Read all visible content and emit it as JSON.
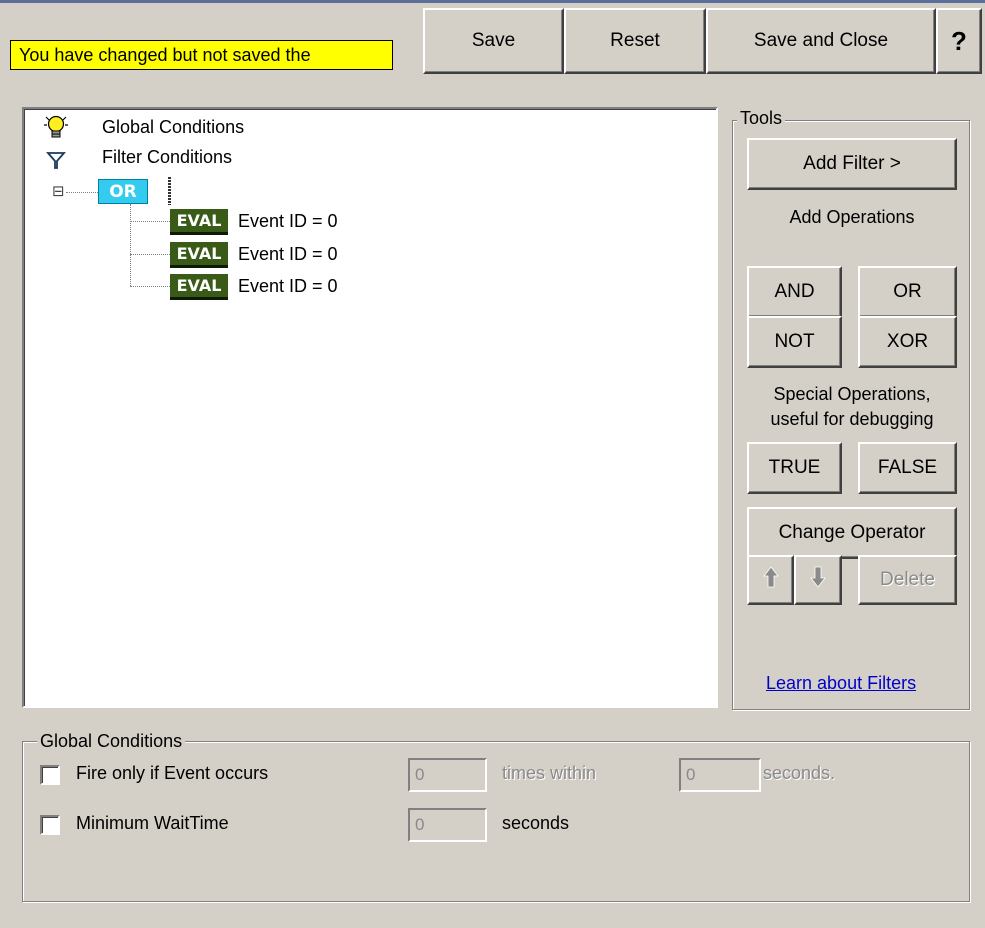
{
  "header": {
    "warning": "You have changed but not saved the",
    "save_label": "Save",
    "reset_label": "Reset",
    "save_close_label": "Save and Close",
    "help_label": "?"
  },
  "tree": {
    "global_conditions": "Global Conditions",
    "filter_conditions": "Filter Conditions",
    "expander": "⊟",
    "or_label": "OR",
    "eval_tag": "EVAL",
    "items": [
      {
        "text": "Event ID = 0"
      },
      {
        "text": "Event ID = 0"
      },
      {
        "text": "Event ID = 0"
      }
    ]
  },
  "tools": {
    "title": "Tools",
    "add_filter": "Add Filter >",
    "add_operations": "Add Operations",
    "and": "AND",
    "or": "OR",
    "not": "NOT",
    "xor": "XOR",
    "special_line1": "Special Operations,",
    "special_line2": "useful for debugging",
    "true": "TRUE",
    "false": "FALSE",
    "change_operator": "Change Operator",
    "delete": "Delete",
    "learn_link": "Learn about Filters"
  },
  "global": {
    "title": "Global Conditions",
    "fire_label": "Fire only if Event occurs",
    "fire_count": "0",
    "times_within": "times within",
    "fire_seconds": "0",
    "seconds_suffix": "seconds.",
    "min_wait_label": "Minimum WaitTime",
    "min_wait_value": "0",
    "seconds_label": "seconds"
  },
  "colors": {
    "warning_bg": "#ffff00",
    "or_tag": "#33ccee",
    "eval_tag": "#3a5a18",
    "link": "#0000cc"
  }
}
